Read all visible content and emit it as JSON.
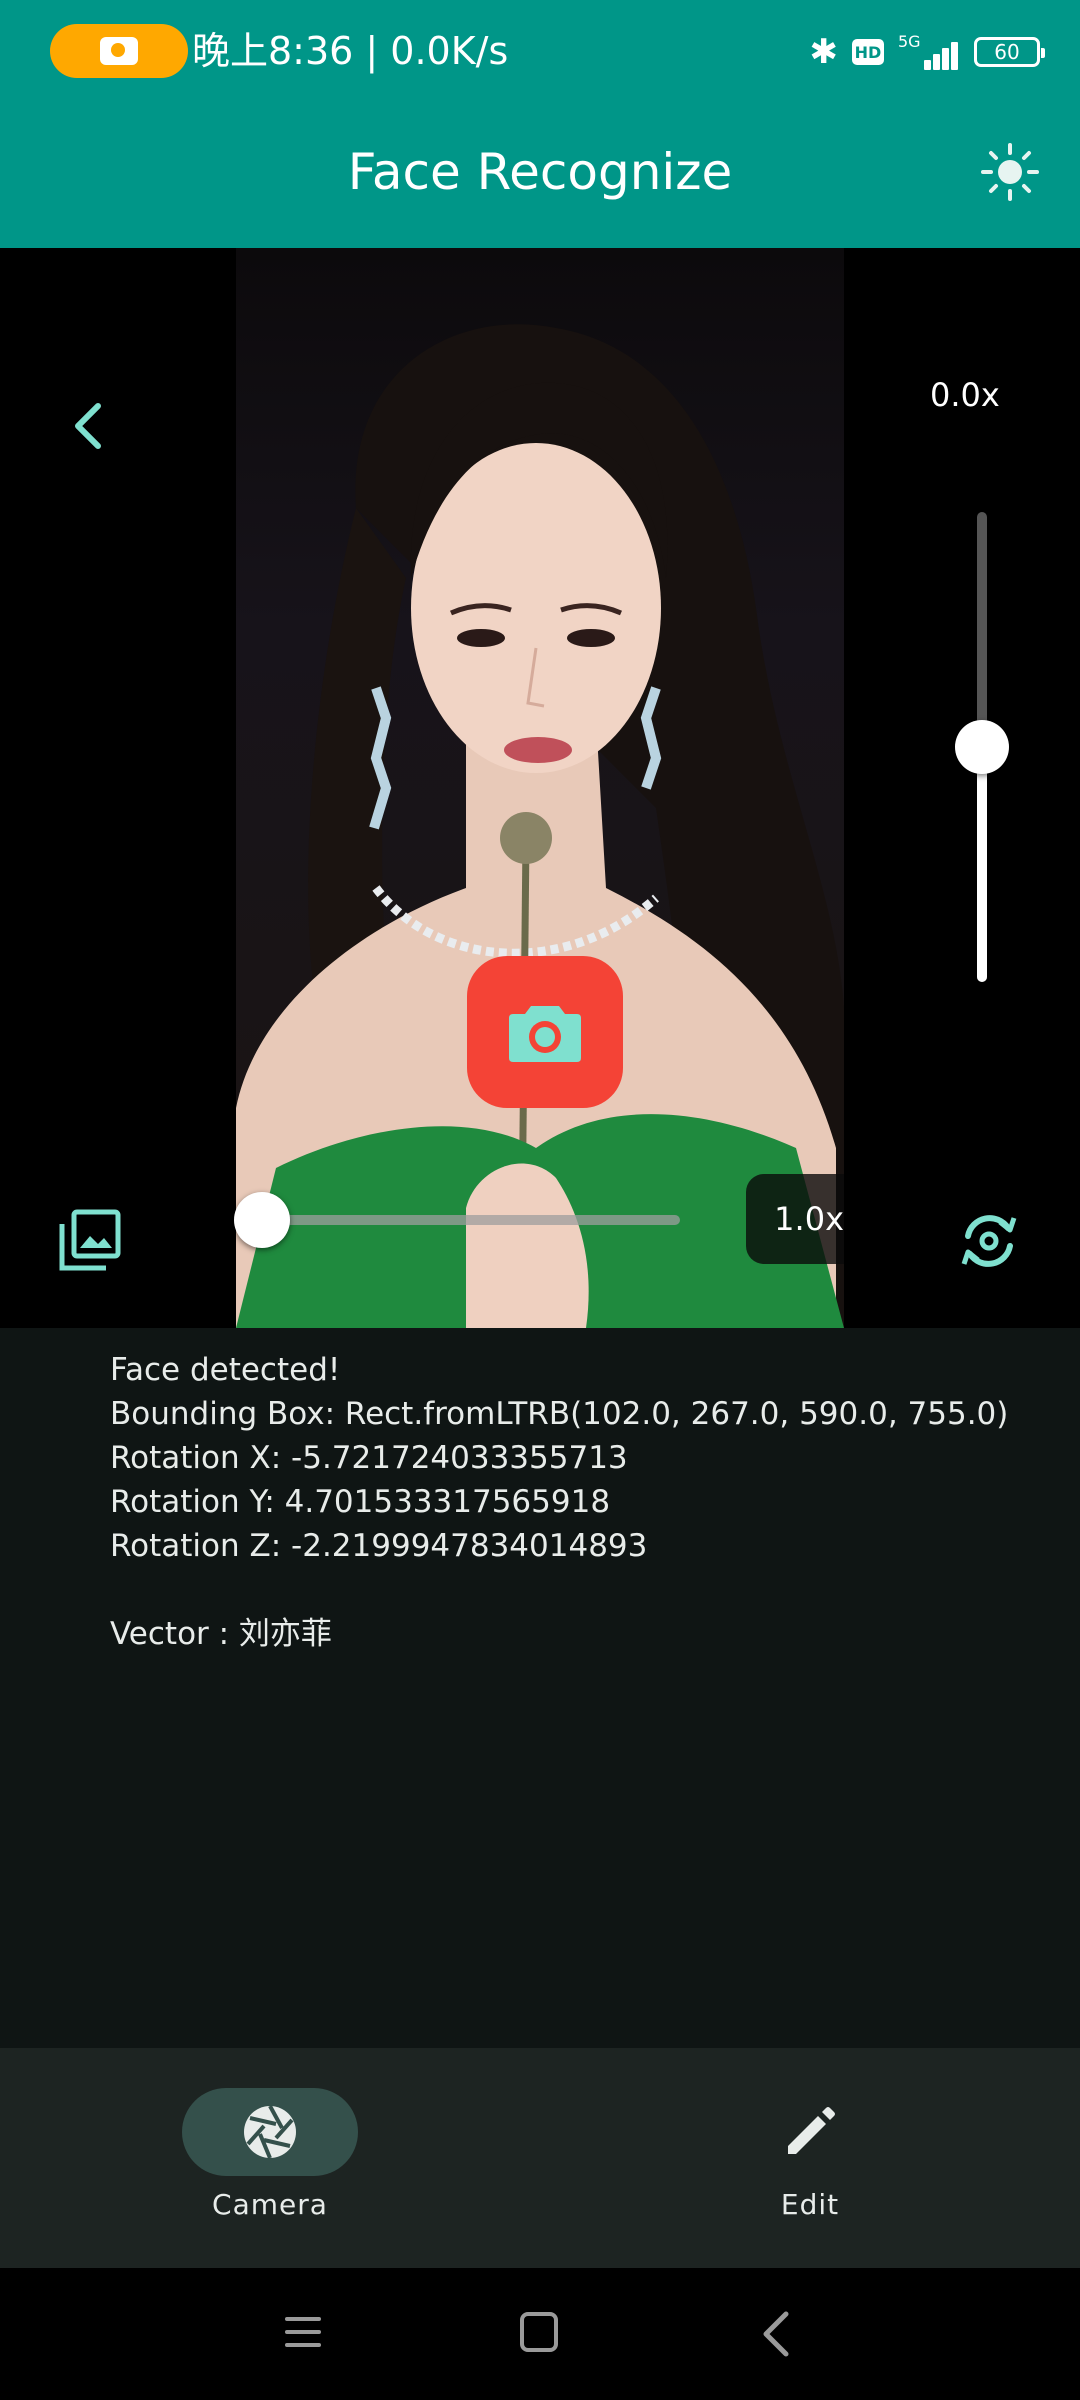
{
  "status_bar": {
    "time_speed": "晚上8:36 | 0.0K/s",
    "network_label": "5G",
    "hd_label": "HD",
    "battery": "60",
    "icons": [
      "camera-icon",
      "bluetooth-icon",
      "hd-icon",
      "signal-icon",
      "battery-icon"
    ]
  },
  "app_bar": {
    "title": "Face Recognize",
    "action_icon": "brightness-icon"
  },
  "camera": {
    "zoom_top_label": "0.0x",
    "zoom_bottom_label": "1.0x",
    "vertical_slider_value": 0.5,
    "horizontal_slider_value": 0.0,
    "icons": [
      "back-icon",
      "gallery-icon",
      "capture-camera-icon",
      "flip-camera-icon"
    ]
  },
  "results": {
    "line1": "Face detected!",
    "line2": "Bounding Box: Rect.fromLTRB(102.0, 267.0, 590.0, 755.0)",
    "line3": "Rotation X: -5.721724033355713",
    "line4": "Rotation Y: 4.701533317565918",
    "line5": "Rotation Z: -2.2199947834014893",
    "line6": "Vector : 刘亦菲"
  },
  "bottom_nav": {
    "items": [
      {
        "label": "Camera",
        "icon": "aperture-icon",
        "selected": true
      },
      {
        "label": "Edit",
        "icon": "pencil-icon",
        "selected": false
      }
    ]
  },
  "colors": {
    "primary": "#009688",
    "accent_icon": "#7fe0cf",
    "capture_button": "#f44336",
    "status_pill": "#ffa800",
    "background": "#0f1514"
  }
}
